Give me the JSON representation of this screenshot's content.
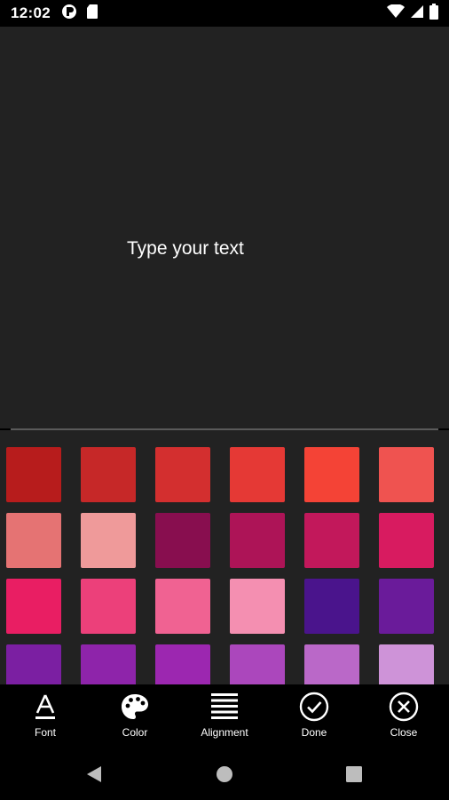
{
  "status_bar": {
    "time": "12:02"
  },
  "canvas": {
    "placeholder_text": "Type your text"
  },
  "palette": {
    "colors": [
      "#b71c1c",
      "#c62828",
      "#d32f2f",
      "#e53935",
      "#f44336",
      "#ef5350",
      "#e57373",
      "#ef9a9a",
      "#880e4f",
      "#ad1457",
      "#c2185b",
      "#d81b60",
      "#e91e63",
      "#ec407a",
      "#f06292",
      "#f48fb1",
      "#4a148c",
      "#6a1b9a",
      "#7b1fa2",
      "#8e24aa",
      "#9c27b0",
      "#ab47bc",
      "#ba68c8",
      "#ce93d8"
    ]
  },
  "toolbar": {
    "font_label": "Font",
    "color_label": "Color",
    "alignment_label": "Alignment",
    "done_label": "Done",
    "close_label": "Close"
  }
}
